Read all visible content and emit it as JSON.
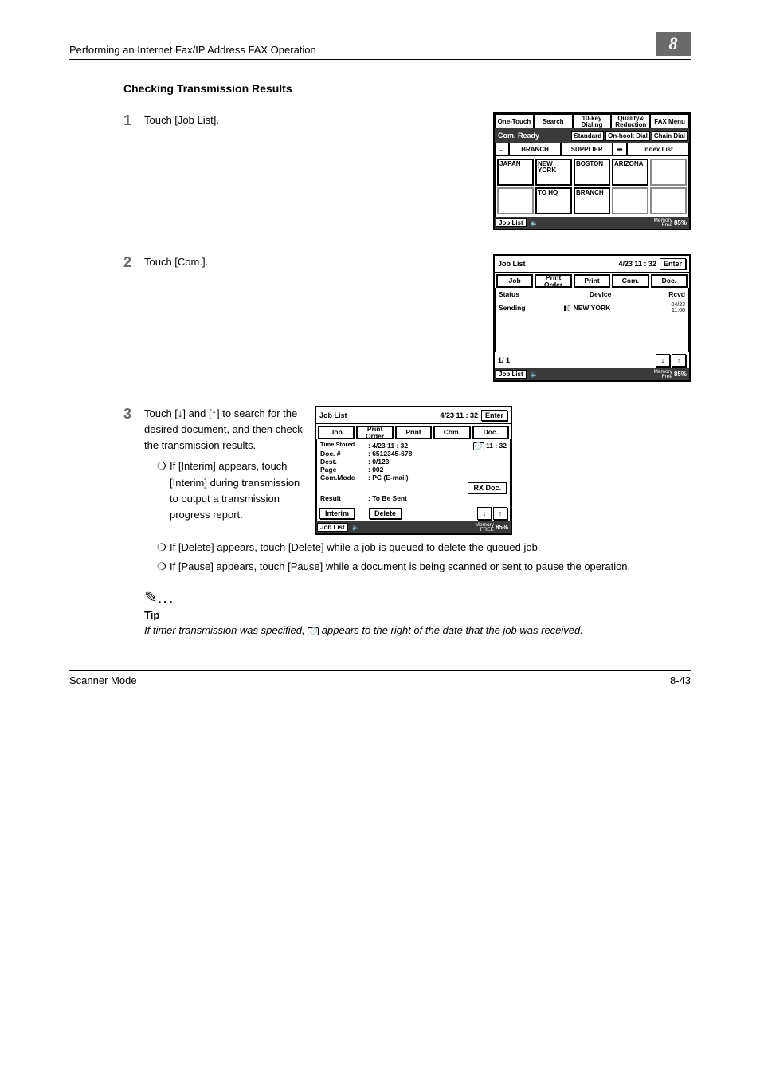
{
  "running_header": {
    "title": "Performing an Internet Fax/IP Address FAX Operation",
    "chapter_number": "8"
  },
  "section_title": "Checking Transmission Results",
  "steps": {
    "s1": {
      "num": "1",
      "text": "Touch [Job List]."
    },
    "s2": {
      "num": "2",
      "text": "Touch [Com.]."
    },
    "s3": {
      "num": "3",
      "text": "Touch [↓] and [↑] to search for the desired document, and then check the transmission results.",
      "bullets": {
        "b1": "If [Interim] appears, touch [Interim] during transmission to output a transmission progress report.",
        "b2": "If [Delete] appears, touch [Delete] while a job is queued to delete the queued job.",
        "b3": "If [Pause] appears, touch [Pause] while a document is being scanned or sent to pause the operation."
      }
    }
  },
  "tip": {
    "label": "Tip",
    "text_before": "If timer transmission was specified, ",
    "text_after": " appears to the right of the date that the job was received."
  },
  "panel1": {
    "top_tabs": {
      "t1": "One-Touch",
      "t2": "Search",
      "t3_l1": "10-key",
      "t3_l2": "Dialing",
      "t4_l1": "Quality&",
      "t4_l2": "Reduction",
      "t5": "FAX Menu"
    },
    "status": "Com. Ready",
    "std_btn": "Standard",
    "onhook": "On-hook Dial",
    "chain": "Chain Dial",
    "nav": {
      "left_arrow": "←",
      "branch": "BRANCH",
      "supplier": "SUPPLIER",
      "right_arrow": "➡",
      "index": "Index List"
    },
    "grid": {
      "c1": "JAPAN",
      "c2": "NEW YORK",
      "c3": "BOSTON",
      "c4": "ARIZONA",
      "c7": "TO HQ",
      "c8": "BRANCH"
    },
    "bottom": {
      "joblist": "Job List",
      "mem_label_l1": "Memory",
      "mem_label_l2": "Free",
      "mem_pct": "85%"
    }
  },
  "panel2": {
    "title": "Job List",
    "time": "4/23 11 : 32",
    "enter": "Enter",
    "tabs": {
      "t1": "Job",
      "t2_l1": "Print",
      "t2_l2": "Order",
      "t3": "Print",
      "t4": "Com.",
      "t5": "Doc."
    },
    "head": {
      "status": "Status",
      "device": "Device",
      "rcvd": "Rcvd"
    },
    "row": {
      "status": "Sending",
      "device": "NEW YORK",
      "rcvd_l1": "04/23",
      "rcvd_l2": "11:00"
    },
    "pager": "1/ 1",
    "bottom": {
      "joblist": "Job List",
      "mem_label_l1": "Memory",
      "mem_label_l2": "Free",
      "mem_pct": "85%"
    }
  },
  "panel3": {
    "title": "Job List",
    "time": "4/23 11 : 32",
    "enter": "Enter",
    "tabs": {
      "t1": "Job",
      "t2_l1": "Print",
      "t2_l2": "Order",
      "t3": "Print",
      "t4": "Com.",
      "t5": "Doc."
    },
    "detail": {
      "k_time": "Time Stored",
      "v_time": ": 4/23  11 : 32",
      "k_doc": "Doc. #",
      "v_doc": ": 6512345-678",
      "k_dest": "Dest.",
      "v_dest": ":    0/123",
      "k_page": "Page",
      "v_page": ": 002",
      "k_mode": "Com.Mode",
      "v_mode": ": PC (E-mail)",
      "k_result": "Result",
      "v_result": ": To Be Sent",
      "right_time": "11 : 32",
      "rx_btn": "RX Doc."
    },
    "actions": {
      "interim": "Interim",
      "delete": "Delete"
    },
    "bottom": {
      "joblist": "Job List",
      "mem_label_l1": "Memory",
      "mem_label_l2": "FREE",
      "mem_pct": "85%"
    }
  },
  "footer": {
    "left": "Scanner Mode",
    "right": "8-43"
  }
}
